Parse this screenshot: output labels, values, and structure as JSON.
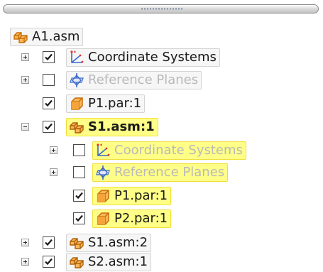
{
  "splitter": {
    "grip": "dotted-grip"
  },
  "tree": {
    "nodes": [
      {
        "id": "a1-asm",
        "label": "A1.asm",
        "icon": "assembly-icon",
        "checked": null,
        "expander": null,
        "dim": false,
        "bold": false,
        "highlight": false
      },
      {
        "id": "coord-1",
        "label": "Coordinate Systems",
        "icon": "coordinate-system-icon",
        "checked": true,
        "expander": "plus",
        "dim": false,
        "bold": false,
        "highlight": false
      },
      {
        "id": "refplanes-1",
        "label": "Reference Planes",
        "icon": "reference-plane-icon",
        "checked": false,
        "expander": "plus",
        "dim": true,
        "bold": false,
        "highlight": false
      },
      {
        "id": "p1-par-1",
        "label": "P1.par:1",
        "icon": "part-icon",
        "checked": true,
        "expander": null,
        "dim": false,
        "bold": false,
        "highlight": false
      },
      {
        "id": "s1-asm-1",
        "label": "S1.asm:1",
        "icon": "subassembly-icon",
        "checked": true,
        "expander": "minus",
        "dim": false,
        "bold": true,
        "highlight": true
      },
      {
        "id": "coord-2",
        "label": "Coordinate Systems",
        "icon": "coordinate-system-icon",
        "checked": false,
        "expander": "plus",
        "dim": true,
        "bold": false,
        "highlight": true
      },
      {
        "id": "refplanes-2",
        "label": "Reference Planes",
        "icon": "reference-plane-icon",
        "checked": false,
        "expander": "plus",
        "dim": true,
        "bold": false,
        "highlight": true
      },
      {
        "id": "p1-par-1b",
        "label": "P1.par:1",
        "icon": "part-icon",
        "checked": true,
        "expander": null,
        "dim": false,
        "bold": false,
        "highlight": true
      },
      {
        "id": "p2-par-1",
        "label": "P2.par:1",
        "icon": "part-icon",
        "checked": true,
        "expander": null,
        "dim": false,
        "bold": false,
        "highlight": true
      },
      {
        "id": "s1-asm-2",
        "label": "S1.asm:2",
        "icon": "subassembly-icon",
        "checked": true,
        "expander": "plus",
        "dim": false,
        "bold": false,
        "highlight": false
      },
      {
        "id": "s2-asm-1",
        "label": "S2.asm:1",
        "icon": "subassembly-icon",
        "checked": true,
        "expander": "plus",
        "dim": false,
        "bold": false,
        "highlight": false
      }
    ]
  },
  "colors": {
    "highlight_fill": "#ffff88",
    "highlight_border": "#f1df3a",
    "icon_orange": "#f29a1f",
    "icon_blue": "#3a68c6",
    "dim_text": "#b9b9b9"
  }
}
